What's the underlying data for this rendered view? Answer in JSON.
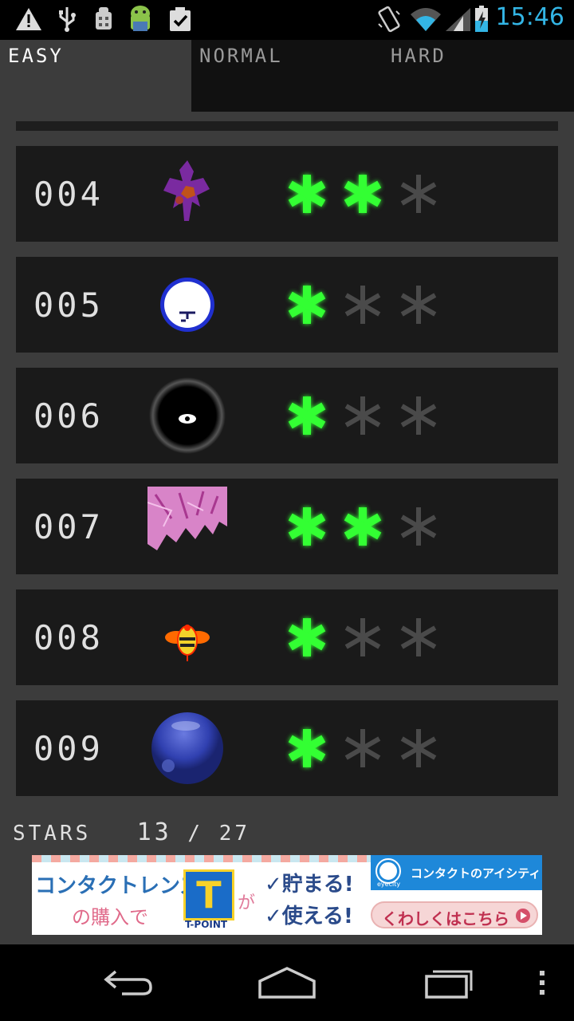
{
  "status_bar": {
    "time": "15:46",
    "icons": [
      "warning-icon",
      "usb-icon",
      "debug-icon",
      "android-icon",
      "clipboard-check-icon",
      "vibrate-icon",
      "wifi-icon",
      "signal-icon",
      "battery-charging-icon"
    ]
  },
  "tabs": [
    {
      "label": "EASY",
      "active": true
    },
    {
      "label": "NORMAL",
      "active": false
    },
    {
      "label": "HARD",
      "active": false
    }
  ],
  "levels": [
    {
      "number": "004",
      "image": "purple-creature-icon",
      "stars": 2
    },
    {
      "number": "005",
      "image": "blue-moon-face-icon",
      "stars": 1
    },
    {
      "number": "006",
      "image": "black-eye-orb-icon",
      "stars": 1
    },
    {
      "number": "007",
      "image": "pink-crystal-icon",
      "stars": 2
    },
    {
      "number": "008",
      "image": "bee-icon",
      "stars": 1
    },
    {
      "number": "009",
      "image": "blue-sphere-icon",
      "stars": 1
    }
  ],
  "max_stars_per_level": 3,
  "stars_summary": {
    "label": "STARS",
    "count": "13",
    "separator": "/",
    "total": "27"
  },
  "ad": {
    "text_line1": "コンタクトレンズ",
    "text_line2": "の購入で",
    "t_logo": "T",
    "t_point": "T-POINT",
    "particle": "が",
    "save_label": "✓貯まる!",
    "use_label": "✓使える!",
    "brand_small": "eyecity",
    "brand_name": "コンタクトのアイシティ",
    "cta_label": "くわしくはこちら"
  },
  "navbar": {
    "icons": [
      "back-icon",
      "home-icon",
      "recent-apps-icon",
      "overflow-menu-icon"
    ]
  },
  "colors": {
    "star_on": "#33ff33",
    "star_off": "#4a4a4a",
    "background": "#3c3c3c",
    "row": "#1a1a1a",
    "clock": "#33b5e5"
  }
}
